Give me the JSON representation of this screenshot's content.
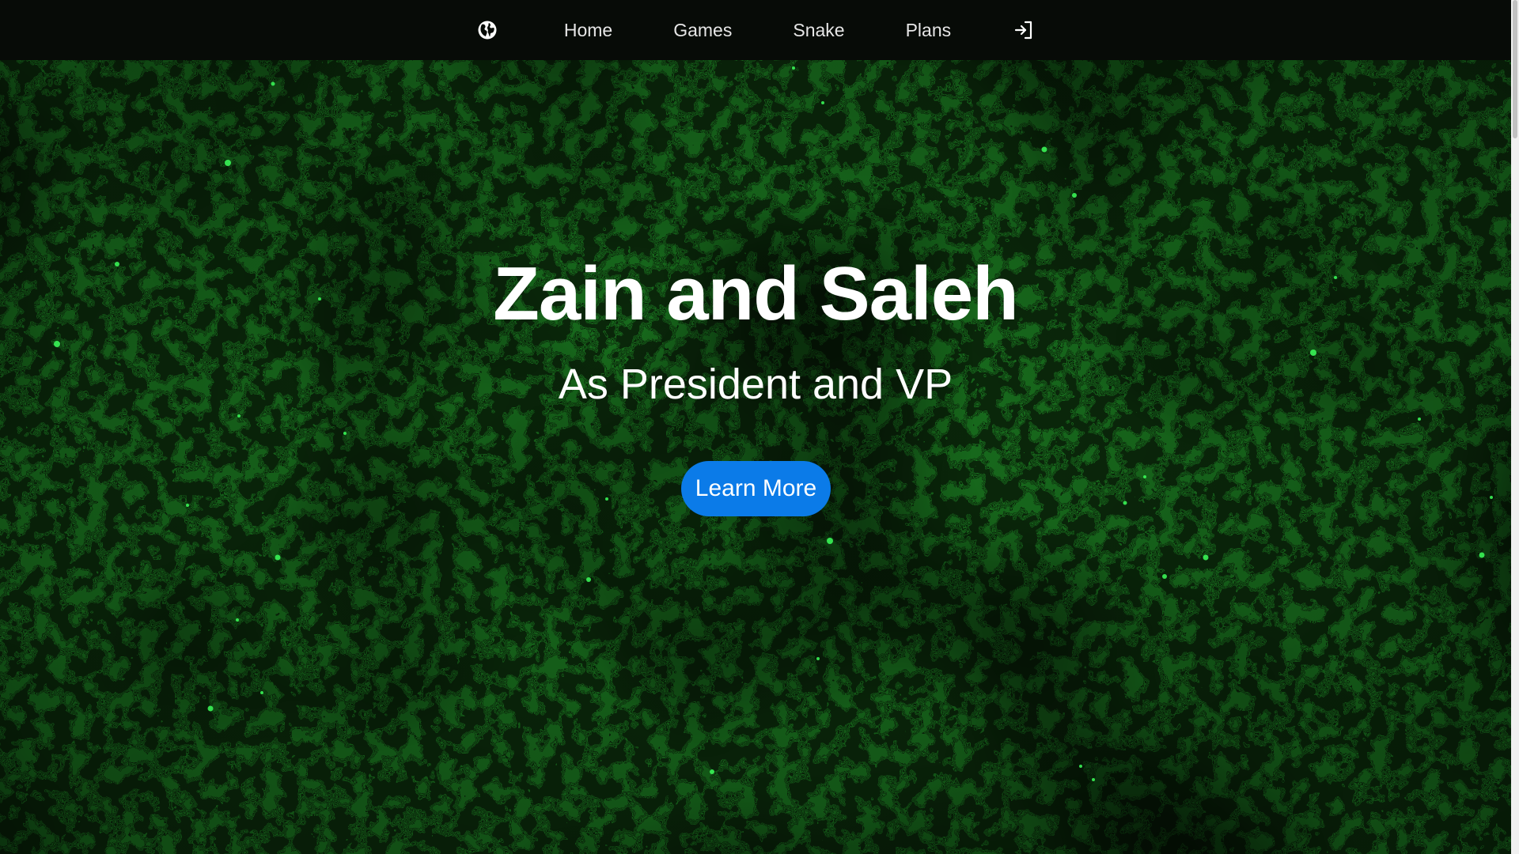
{
  "nav": {
    "brand_icon": "globe-icon",
    "links": [
      "Home",
      "Games",
      "Snake",
      "Plans"
    ],
    "login_icon": "sign-in-icon"
  },
  "hero": {
    "title": "Zain and Saleh",
    "subtitle": "As President and VP",
    "button_label": "Learn More"
  },
  "colors": {
    "navbar_bg": "#070b07",
    "hero_bg": "#0a2a0a",
    "accent_green": "#2fd14a",
    "button_blue": "#0b7be8"
  }
}
